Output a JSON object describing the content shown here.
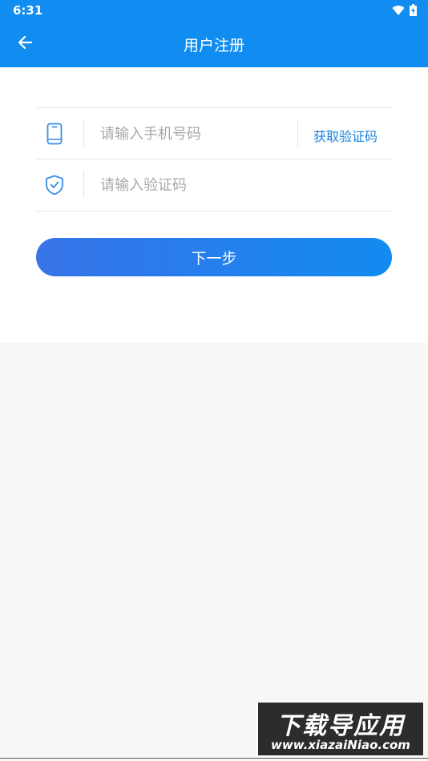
{
  "status_bar": {
    "time": "6:31"
  },
  "header": {
    "title": "用户注册"
  },
  "form": {
    "phone": {
      "placeholder": "请输入手机号码",
      "value": ""
    },
    "get_code_label": "获取验证码",
    "code": {
      "placeholder": "请输入验证码",
      "value": ""
    },
    "next_label": "下一步"
  },
  "watermark": {
    "title": "下载导应用",
    "url": "www.xiazaiNiao.com"
  },
  "colors": {
    "accent": "#118cf0",
    "link": "#1b82e0",
    "background": "#f7f7f8"
  },
  "icons": [
    "back-arrow-icon",
    "wifi-icon",
    "battery-icon",
    "phone-icon",
    "shield-check-icon"
  ]
}
